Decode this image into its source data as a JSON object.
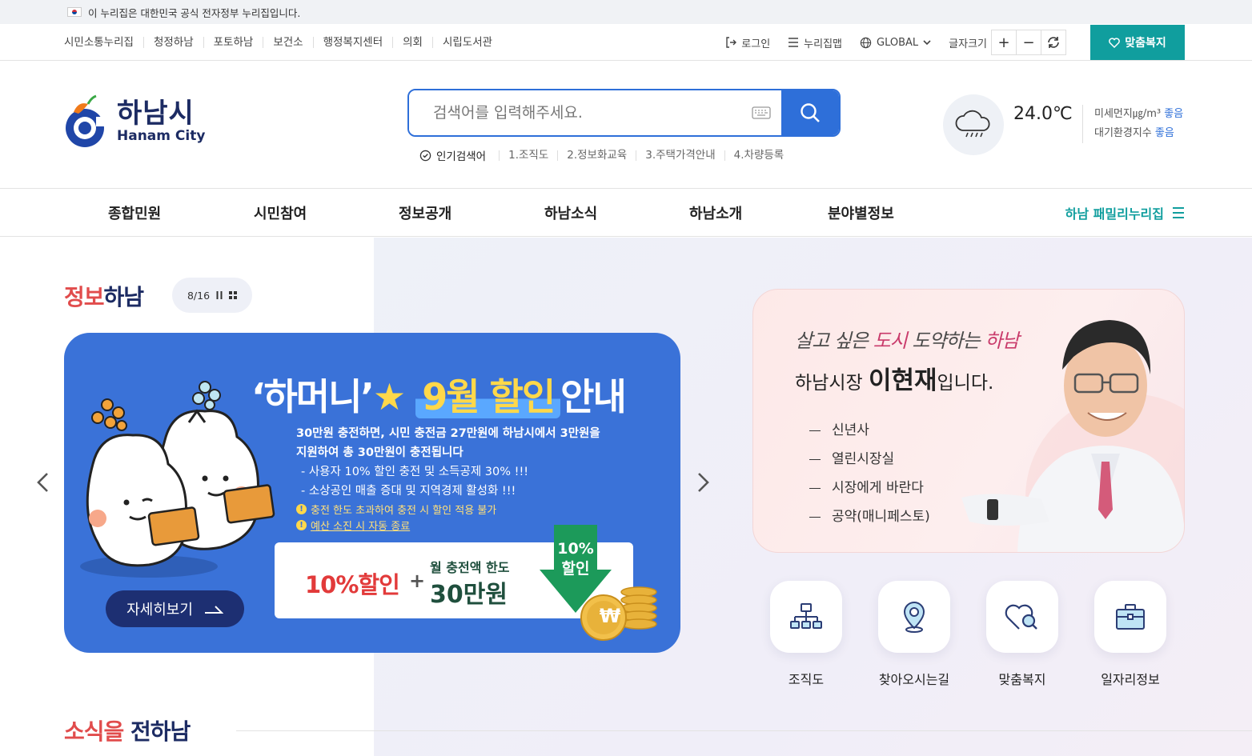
{
  "gov_banner": {
    "text": "이 누리집은 대한민국 공식 전자정부 누리집입니다."
  },
  "family_links": [
    "시민소통누리집",
    "청정하남",
    "포토하남",
    "보건소",
    "행정복지센터",
    "의회",
    "시립도서관"
  ],
  "util": {
    "login": "로그인",
    "sitemap": "누리집맵",
    "global": "GLOBAL",
    "font_size": "글자크기",
    "font_plus": "+",
    "font_minus": "−",
    "my_welfare": "맞춤복지"
  },
  "logo": {
    "kr": "하남시",
    "en": "Hanam City"
  },
  "search": {
    "placeholder": "검색어를 입력해주세요.",
    "popular_title": "인기검색어",
    "keywords": [
      "1.조직도",
      "2.정보화교육",
      "3.주택가격안내",
      "4.차량등록"
    ]
  },
  "weather": {
    "temp": "24.0℃",
    "dust_label": "미세먼지㎍/m³",
    "dust_value": "좋음",
    "air_label": "대기환경지수",
    "air_value": "좋음"
  },
  "gnb": [
    "종합민원",
    "시민참여",
    "정보공개",
    "하남소식",
    "하남소개",
    "분야별정보"
  ],
  "family_site": "하남 패밀리누리집",
  "info_section": {
    "title_red": "정보",
    "title_navy": "하남",
    "pager": "8/16"
  },
  "banner": {
    "title_quote": "‘하머니’",
    "title_month": "9월 할인",
    "title_guide": "안내",
    "line1": "30만원 충전하면, 시민 충전금 27만원에 하남시에서 3만원을",
    "line2": "지원하여 총 30만원이 충전됩니다",
    "line3": "- 사용자 10% 할인 충전 및 소득공제 30% !!!",
    "line4": "- 소상공인 매출 증대 및 지역경제 활성화 !!!",
    "warn1": "충전 한도 초과하여 충전 시 할인 적용 불가",
    "warn2": "예산 소진 시 자동 종료",
    "discount": "10%할인",
    "plus": "+",
    "limit_sub": "월 충전액 한도",
    "limit": "30만원",
    "arrow_pct": "10%",
    "arrow_word": "할인",
    "coin": "₩",
    "detail_button": "자세히보기"
  },
  "mayor": {
    "slogan_a": "살고 싶은 ",
    "slogan_b": "도시",
    "slogan_c": " 도약하는 ",
    "slogan_d": "하남",
    "name_pre": "하남시장 ",
    "name": "이현재",
    "name_post": "입니다.",
    "links": [
      "신년사",
      "열린시장실",
      "시장에게 바란다",
      "공약(매니페스토)"
    ]
  },
  "quick_menu": [
    "조직도",
    "찾아오시는길",
    "맞춤복지",
    "일자리정보"
  ],
  "news_section": {
    "title_red": "소식을",
    "title_navy": " 전하남"
  },
  "colors": {
    "brand_teal": "#109e9e",
    "brand_navy": "#1c2b63",
    "search_blue": "#2e6fd9",
    "banner_blue": "#3a72d8",
    "accent_red": "#e14c4c"
  }
}
